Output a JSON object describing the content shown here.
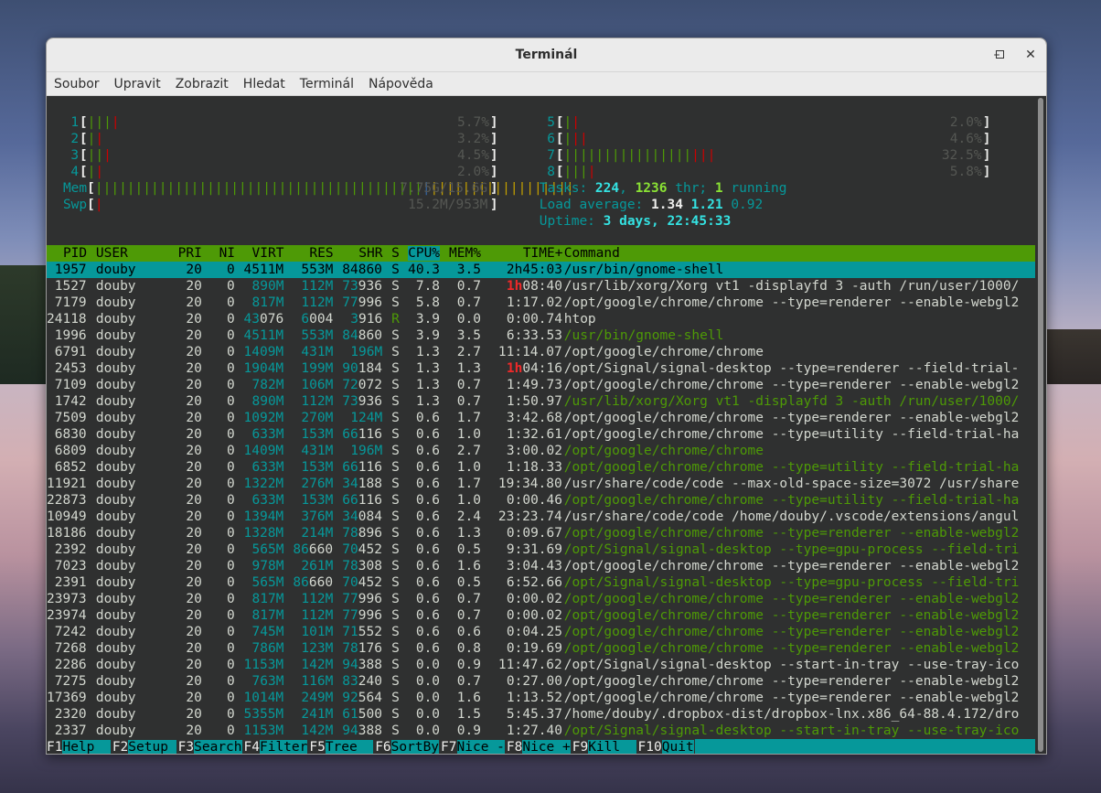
{
  "window": {
    "title": "Terminál",
    "minimize_icon": "minimize-icon",
    "maximize_icon": "maximize-icon",
    "close_icon": "close-icon"
  },
  "menu": [
    "Soubor",
    "Upravit",
    "Zobrazit",
    "Hledat",
    "Terminál",
    "Nápověda"
  ],
  "meters": {
    "cpus": [
      {
        "id": "1",
        "pct": "5.7%",
        "bars": [
          [
            "c-green",
            "|||"
          ],
          [
            "c-red",
            "|"
          ]
        ]
      },
      {
        "id": "2",
        "pct": "3.2%",
        "bars": [
          [
            "c-green",
            "|"
          ],
          [
            "c-red",
            "|"
          ]
        ]
      },
      {
        "id": "3",
        "pct": "4.5%",
        "bars": [
          [
            "c-green",
            "||"
          ],
          [
            "c-red",
            "|"
          ]
        ]
      },
      {
        "id": "4",
        "pct": "2.0%",
        "bars": [
          [
            "c-green",
            "|"
          ],
          [
            "c-red",
            "|"
          ]
        ]
      },
      {
        "id": "5",
        "pct": "2.0%",
        "bars": [
          [
            "c-green",
            "|"
          ],
          [
            "c-red",
            "|"
          ]
        ]
      },
      {
        "id": "6",
        "pct": "4.6%",
        "bars": [
          [
            "c-green",
            "|"
          ],
          [
            "c-red",
            "||"
          ]
        ]
      },
      {
        "id": "7",
        "pct": "32.5%",
        "bars": [
          [
            "c-green",
            "||||||||||||||||"
          ],
          [
            "c-red",
            "|||"
          ]
        ]
      },
      {
        "id": "8",
        "pct": "5.8%",
        "bars": [
          [
            "c-green",
            "|||"
          ],
          [
            "c-red",
            "|"
          ]
        ]
      }
    ],
    "mem": {
      "label": "Mem",
      "bars": [
        [
          "c-green",
          "|||||||||||||||||||||||||||||||||||||||||"
        ],
        [
          "c-blue",
          "|"
        ],
        [
          "c-yellow",
          "||||||||||||||||||"
        ]
      ],
      "value": "7.75G/15.6G"
    },
    "swp": {
      "label": "Swp",
      "bars": [
        [
          "c-red",
          "|"
        ]
      ],
      "value": "15.2M/953M"
    },
    "tasks": {
      "label": "Tasks: ",
      "count": "224",
      "sep": ", ",
      "thr": "1236",
      "thr_label": " thr; ",
      "running": "1",
      "running_label": " running"
    },
    "load": {
      "label": "Load average: ",
      "l1": "1.34",
      "l5": "1.21",
      "l15": "0.92"
    },
    "uptime": {
      "label": "Uptime: ",
      "value": "3 days, 22:45:33"
    }
  },
  "table": {
    "headers": {
      "pid": "PID",
      "user": "USER",
      "pri": "PRI",
      "ni": "NI",
      "virt": "VIRT",
      "res": "RES",
      "shr": "SHR",
      "s": "S",
      "cpu": "CPU%",
      "mem": "MEM%",
      "time": "TIME+",
      "cmd": "Command"
    },
    "rows": [
      [
        "1957",
        "douby",
        "20",
        "0",
        "4511M",
        "553M",
        "84860",
        "S",
        "40.3",
        "3.5",
        "2h45:03",
        "/usr/bin/gnome-shell",
        0
      ],
      [
        "1527",
        "douby",
        "20",
        "0",
        "890M",
        "112M",
        "73936",
        "S",
        "7.8",
        "0.7",
        "1h08:40",
        "/usr/lib/xorg/Xorg vt1 -displayfd 3 -auth /run/user/1000/",
        0
      ],
      [
        "7179",
        "douby",
        "20",
        "0",
        "817M",
        "112M",
        "77996",
        "S",
        "5.8",
        "0.7",
        "1:17.02",
        "/opt/google/chrome/chrome --type=renderer --enable-webgl2",
        0
      ],
      [
        "24118",
        "douby",
        "20",
        "0",
        "43076",
        "6004",
        "3916",
        "R",
        "3.9",
        "0.0",
        "0:00.74",
        "htop",
        0
      ],
      [
        "1996",
        "douby",
        "20",
        "0",
        "4511M",
        "553M",
        "84860",
        "S",
        "3.9",
        "3.5",
        "6:33.53",
        "/usr/bin/gnome-shell",
        1
      ],
      [
        "6791",
        "douby",
        "20",
        "0",
        "1409M",
        "431M",
        "196M",
        "S",
        "1.3",
        "2.7",
        "11:14.07",
        "/opt/google/chrome/chrome",
        0
      ],
      [
        "2453",
        "douby",
        "20",
        "0",
        "1904M",
        "199M",
        "90184",
        "S",
        "1.3",
        "1.3",
        "1h04:16",
        "/opt/Signal/signal-desktop --type=renderer --field-trial-",
        0
      ],
      [
        "7109",
        "douby",
        "20",
        "0",
        "782M",
        "106M",
        "72072",
        "S",
        "1.3",
        "0.7",
        "1:49.73",
        "/opt/google/chrome/chrome --type=renderer --enable-webgl2",
        0
      ],
      [
        "1742",
        "douby",
        "20",
        "0",
        "890M",
        "112M",
        "73936",
        "S",
        "1.3",
        "0.7",
        "1:50.97",
        "/usr/lib/xorg/Xorg vt1 -displayfd 3 -auth /run/user/1000/",
        1
      ],
      [
        "7509",
        "douby",
        "20",
        "0",
        "1092M",
        "270M",
        "124M",
        "S",
        "0.6",
        "1.7",
        "3:42.68",
        "/opt/google/chrome/chrome --type=renderer --enable-webgl2",
        0
      ],
      [
        "6830",
        "douby",
        "20",
        "0",
        "633M",
        "153M",
        "66116",
        "S",
        "0.6",
        "1.0",
        "1:32.61",
        "/opt/google/chrome/chrome --type=utility --field-trial-ha",
        0
      ],
      [
        "6809",
        "douby",
        "20",
        "0",
        "1409M",
        "431M",
        "196M",
        "S",
        "0.6",
        "2.7",
        "3:00.02",
        "/opt/google/chrome/chrome",
        1
      ],
      [
        "6852",
        "douby",
        "20",
        "0",
        "633M",
        "153M",
        "66116",
        "S",
        "0.6",
        "1.0",
        "1:18.33",
        "/opt/google/chrome/chrome --type=utility --field-trial-ha",
        1
      ],
      [
        "11921",
        "douby",
        "20",
        "0",
        "1322M",
        "276M",
        "34188",
        "S",
        "0.6",
        "1.7",
        "19:34.80",
        "/usr/share/code/code --max-old-space-size=3072 /usr/share",
        0
      ],
      [
        "22873",
        "douby",
        "20",
        "0",
        "633M",
        "153M",
        "66116",
        "S",
        "0.6",
        "1.0",
        "0:00.46",
        "/opt/google/chrome/chrome --type=utility --field-trial-ha",
        1
      ],
      [
        "10949",
        "douby",
        "20",
        "0",
        "1394M",
        "376M",
        "34084",
        "S",
        "0.6",
        "2.4",
        "23:23.74",
        "/usr/share/code/code /home/douby/.vscode/extensions/angul",
        0
      ],
      [
        "18186",
        "douby",
        "20",
        "0",
        "1328M",
        "214M",
        "78896",
        "S",
        "0.6",
        "1.3",
        "0:09.67",
        "/opt/google/chrome/chrome --type=renderer --enable-webgl2",
        1
      ],
      [
        "2392",
        "douby",
        "20",
        "0",
        "565M",
        "86660",
        "70452",
        "S",
        "0.6",
        "0.5",
        "9:31.69",
        "/opt/Signal/signal-desktop --type=gpu-process --field-tri",
        1
      ],
      [
        "7023",
        "douby",
        "20",
        "0",
        "978M",
        "261M",
        "78308",
        "S",
        "0.6",
        "1.6",
        "3:04.43",
        "/opt/google/chrome/chrome --type=renderer --enable-webgl2",
        0
      ],
      [
        "2391",
        "douby",
        "20",
        "0",
        "565M",
        "86660",
        "70452",
        "S",
        "0.6",
        "0.5",
        "6:52.66",
        "/opt/Signal/signal-desktop --type=gpu-process --field-tri",
        1
      ],
      [
        "23973",
        "douby",
        "20",
        "0",
        "817M",
        "112M",
        "77996",
        "S",
        "0.6",
        "0.7",
        "0:00.02",
        "/opt/google/chrome/chrome --type=renderer --enable-webgl2",
        1
      ],
      [
        "23974",
        "douby",
        "20",
        "0",
        "817M",
        "112M",
        "77996",
        "S",
        "0.6",
        "0.7",
        "0:00.02",
        "/opt/google/chrome/chrome --type=renderer --enable-webgl2",
        1
      ],
      [
        "7242",
        "douby",
        "20",
        "0",
        "745M",
        "101M",
        "71552",
        "S",
        "0.6",
        "0.6",
        "0:04.25",
        "/opt/google/chrome/chrome --type=renderer --enable-webgl2",
        1
      ],
      [
        "7268",
        "douby",
        "20",
        "0",
        "786M",
        "123M",
        "78176",
        "S",
        "0.6",
        "0.8",
        "0:19.69",
        "/opt/google/chrome/chrome --type=renderer --enable-webgl2",
        1
      ],
      [
        "2286",
        "douby",
        "20",
        "0",
        "1153M",
        "142M",
        "94388",
        "S",
        "0.0",
        "0.9",
        "11:47.62",
        "/opt/Signal/signal-desktop --start-in-tray --use-tray-ico",
        0
      ],
      [
        "7275",
        "douby",
        "20",
        "0",
        "763M",
        "116M",
        "83240",
        "S",
        "0.0",
        "0.7",
        "0:27.00",
        "/opt/google/chrome/chrome --type=renderer --enable-webgl2",
        0
      ],
      [
        "17369",
        "douby",
        "20",
        "0",
        "1014M",
        "249M",
        "92564",
        "S",
        "0.0",
        "1.6",
        "1:13.52",
        "/opt/google/chrome/chrome --type=renderer --enable-webgl2",
        0
      ],
      [
        "2320",
        "douby",
        "20",
        "0",
        "5355M",
        "241M",
        "61500",
        "S",
        "0.0",
        "1.5",
        "5:45.37",
        "/home/douby/.dropbox-dist/dropbox-lnx.x86_64-88.4.172/dro",
        0
      ],
      [
        "2337",
        "douby",
        "20",
        "0",
        "1153M",
        "142M",
        "94388",
        "S",
        "0.0",
        "0.9",
        "1:27.40",
        "/opt/Signal/signal-desktop --start-in-tray --use-tray-ico",
        1
      ]
    ]
  },
  "fkeys": [
    [
      "F1",
      "Help  "
    ],
    [
      "F2",
      "Setup "
    ],
    [
      "F3",
      "Search"
    ],
    [
      "F4",
      "Filter"
    ],
    [
      "F5",
      "Tree  "
    ],
    [
      "F6",
      "SortBy"
    ],
    [
      "F7",
      "Nice -"
    ],
    [
      "F8",
      "Nice +"
    ],
    [
      "F9",
      "Kill  "
    ],
    [
      "F10",
      "Quit"
    ]
  ]
}
